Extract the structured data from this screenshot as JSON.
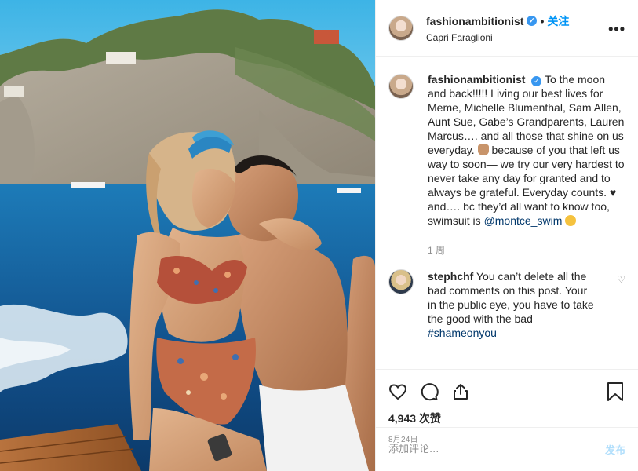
{
  "post": {
    "username": "fashionambitionist",
    "verified_badge": "✓",
    "dot": "•",
    "follow_label": "关注",
    "location": "Capri Faraglioni",
    "more_label": "•••"
  },
  "caption": {
    "username": "fashionambitionist",
    "text_part1": "To the moon and back!!!!! Living our best lives for Meme, Michelle Blumenthal, Sam Allen, Aunt Sue, Gabe’s Grandparents, Lauren Marcus…. and all those that shine on us everyday.",
    "text_part2": "because of you that left us way to soon— we try our very hardest to never take any day for granted and to always be grateful. Everyday counts. ♥ and…. bc they’d all want to know too, swimsuit is",
    "mention": "@montce_swim",
    "age": "1 周"
  },
  "comment": {
    "username": "stephchf",
    "text": "You can’t delete all the bad comments on this post. Your in the public eye, you have to take the good with the bad",
    "hashtag": "#shameonyou",
    "like_icon": "♡"
  },
  "actions": {
    "likes": "4,943 次赞",
    "date": "8月24日",
    "icons": [
      "heart-icon",
      "comment-icon",
      "share-icon",
      "bookmark-icon"
    ]
  },
  "add_comment": {
    "placeholder": "添加评论...",
    "post_label": "发布"
  },
  "colors": {
    "accent": "#0095f6",
    "verified": "#3897f0",
    "border": "#efefef",
    "muted": "#8e8e8e"
  }
}
